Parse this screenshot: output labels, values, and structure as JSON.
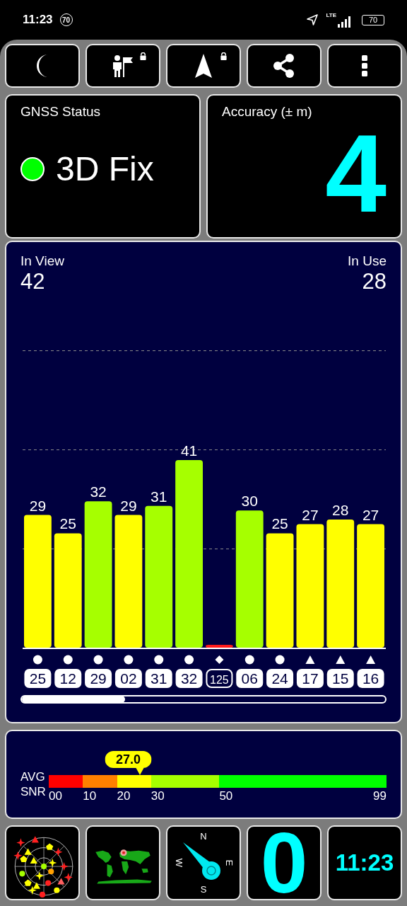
{
  "status_bar": {
    "time": "11:23",
    "notification_badge": "70",
    "network": "LTE",
    "battery": "70"
  },
  "toolbar": [
    {
      "kind": "night-mode",
      "locked": false
    },
    {
      "kind": "waypoint",
      "locked": true
    },
    {
      "kind": "navigate",
      "locked": true
    },
    {
      "kind": "share",
      "locked": false
    },
    {
      "kind": "more",
      "locked": false
    }
  ],
  "gnss_status": {
    "title": "GNSS Status",
    "value": "3D Fix",
    "color": "#00ff00"
  },
  "accuracy": {
    "title": "Accuracy (± m)",
    "value": "4"
  },
  "satellites_panel": {
    "in_view_label": "In View",
    "in_view": "42",
    "in_use_label": "In Use",
    "in_use": "28",
    "chart_data": {
      "type": "bar",
      "categories": [
        "25",
        "12",
        "29",
        "02",
        "31",
        "32",
        "125",
        "06",
        "24",
        "17",
        "15",
        "16"
      ],
      "values": [
        29,
        25,
        32,
        29,
        31,
        41,
        0,
        30,
        25,
        27,
        28,
        27
      ],
      "value_labels": [
        "29",
        "25",
        "32",
        "29",
        "31",
        "41",
        null,
        "30",
        "25",
        "27",
        "28",
        "27"
      ]
    },
    "satellites": [
      {
        "kind": "circle",
        "in_use": true
      },
      {
        "kind": "circle",
        "in_use": true
      },
      {
        "kind": "circle",
        "in_use": true
      },
      {
        "kind": "circle",
        "in_use": true
      },
      {
        "kind": "circle",
        "in_use": true
      },
      {
        "kind": "circle",
        "in_use": true
      },
      {
        "kind": "diamond",
        "in_use": false
      },
      {
        "kind": "circle",
        "in_use": true
      },
      {
        "kind": "circle",
        "in_use": true
      },
      {
        "kind": "triangle",
        "in_use": true
      },
      {
        "kind": "triangle",
        "in_use": true
      },
      {
        "kind": "triangle",
        "in_use": true
      }
    ]
  },
  "avg_snr": {
    "label_lines": [
      "AVG",
      "SNR"
    ],
    "value": "27.0",
    "level": 0.27,
    "segments": [
      {
        "color": "#ff0000"
      },
      {
        "color": "#ff8000"
      },
      {
        "color": "#ffff00"
      },
      {
        "color": "#a6ff00"
      },
      {
        "color": "#00ff00"
      }
    ],
    "ticks": [
      "00",
      "10",
      "20",
      "30",
      "50",
      "99"
    ]
  },
  "tiles": [
    {
      "kind": "sky-plot"
    },
    {
      "kind": "world-map"
    },
    {
      "kind": "compass",
      "directions": [
        "N",
        "E",
        "S",
        "W"
      ]
    },
    {
      "kind": "counter",
      "value": "0"
    },
    {
      "kind": "clock",
      "value": "11:23"
    }
  ]
}
